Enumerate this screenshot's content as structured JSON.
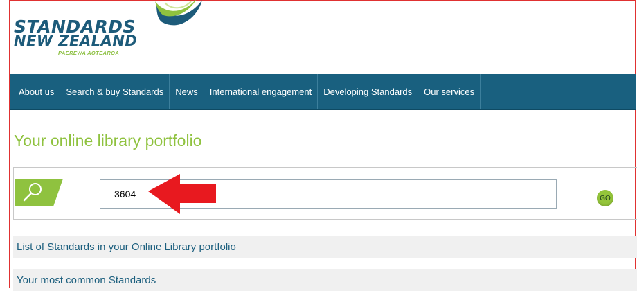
{
  "logo": {
    "line1": "STANDARDS",
    "line2": "NEW ZEALAND",
    "subtitle": "PAEREWA AOTEAROA"
  },
  "nav": {
    "items": [
      {
        "label": "About us"
      },
      {
        "label": "Search & buy Standards"
      },
      {
        "label": "News"
      },
      {
        "label": "International engagement"
      },
      {
        "label": "Developing Standards"
      },
      {
        "label": "Our services"
      }
    ]
  },
  "page": {
    "title": "Your online library portfolio"
  },
  "search": {
    "value": "3604",
    "go_label": "GO"
  },
  "links": {
    "list_label": "List of Standards in your Online Library portfolio",
    "common_label": "Your most common Standards"
  },
  "colors": {
    "nav_bg": "#19607f",
    "accent_green": "#8fc23f",
    "brand_blue": "#1d5b7a",
    "arrow_red": "#e8191f"
  }
}
